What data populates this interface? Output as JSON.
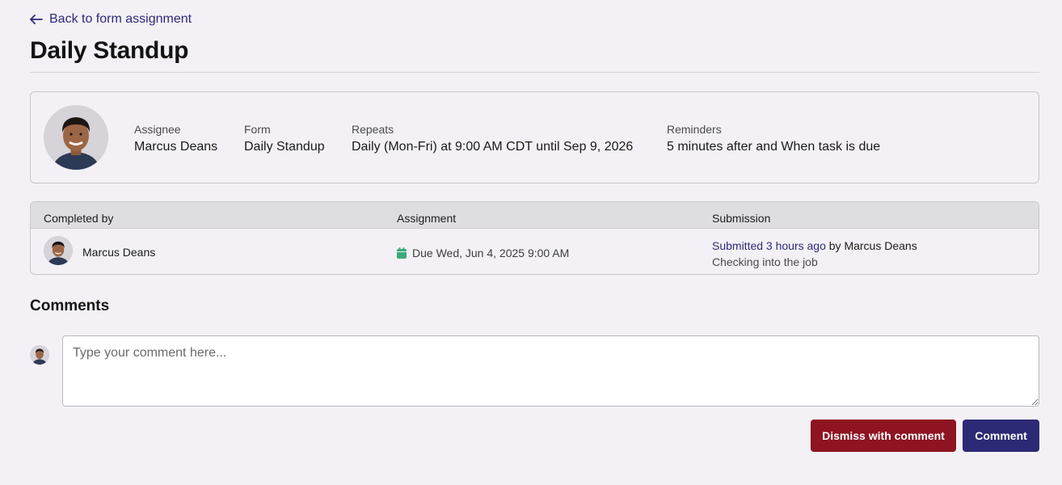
{
  "nav": {
    "back_label": "Back to form assignment"
  },
  "page": {
    "title": "Daily Standup"
  },
  "info": {
    "assignee_label": "Assignee",
    "assignee_value": "Marcus Deans",
    "form_label": "Form",
    "form_value": "Daily Standup",
    "repeats_label": "Repeats",
    "repeats_value": "Daily (Mon-Fri) at 9:00 AM CDT until Sep 9, 2026",
    "reminders_label": "Reminders",
    "reminders_value": "5 minutes after and When task is due"
  },
  "table": {
    "headers": [
      "Completed by",
      "Assignment",
      "Submission"
    ],
    "rows": [
      {
        "completed_by": "Marcus Deans",
        "due": "Due Wed, Jun 4, 2025 9:00 AM",
        "submitted_link": "Submitted 3 hours ago",
        "submitted_by": "by Marcus Deans",
        "note": "Checking into the job"
      }
    ]
  },
  "comments": {
    "title": "Comments",
    "placeholder": "Type your comment here...",
    "dismiss_label": "Dismiss with comment",
    "comment_label": "Comment"
  },
  "icons": {
    "back": "arrow-left-icon",
    "calendar": "calendar-icon",
    "avatar": "user-photo"
  },
  "colors": {
    "link": "#2e2a7a",
    "dismiss_button": "#8e1421",
    "comment_button": "#2c2a74",
    "calendar_icon": "#3fa87a",
    "background": "#f3f1f5"
  }
}
